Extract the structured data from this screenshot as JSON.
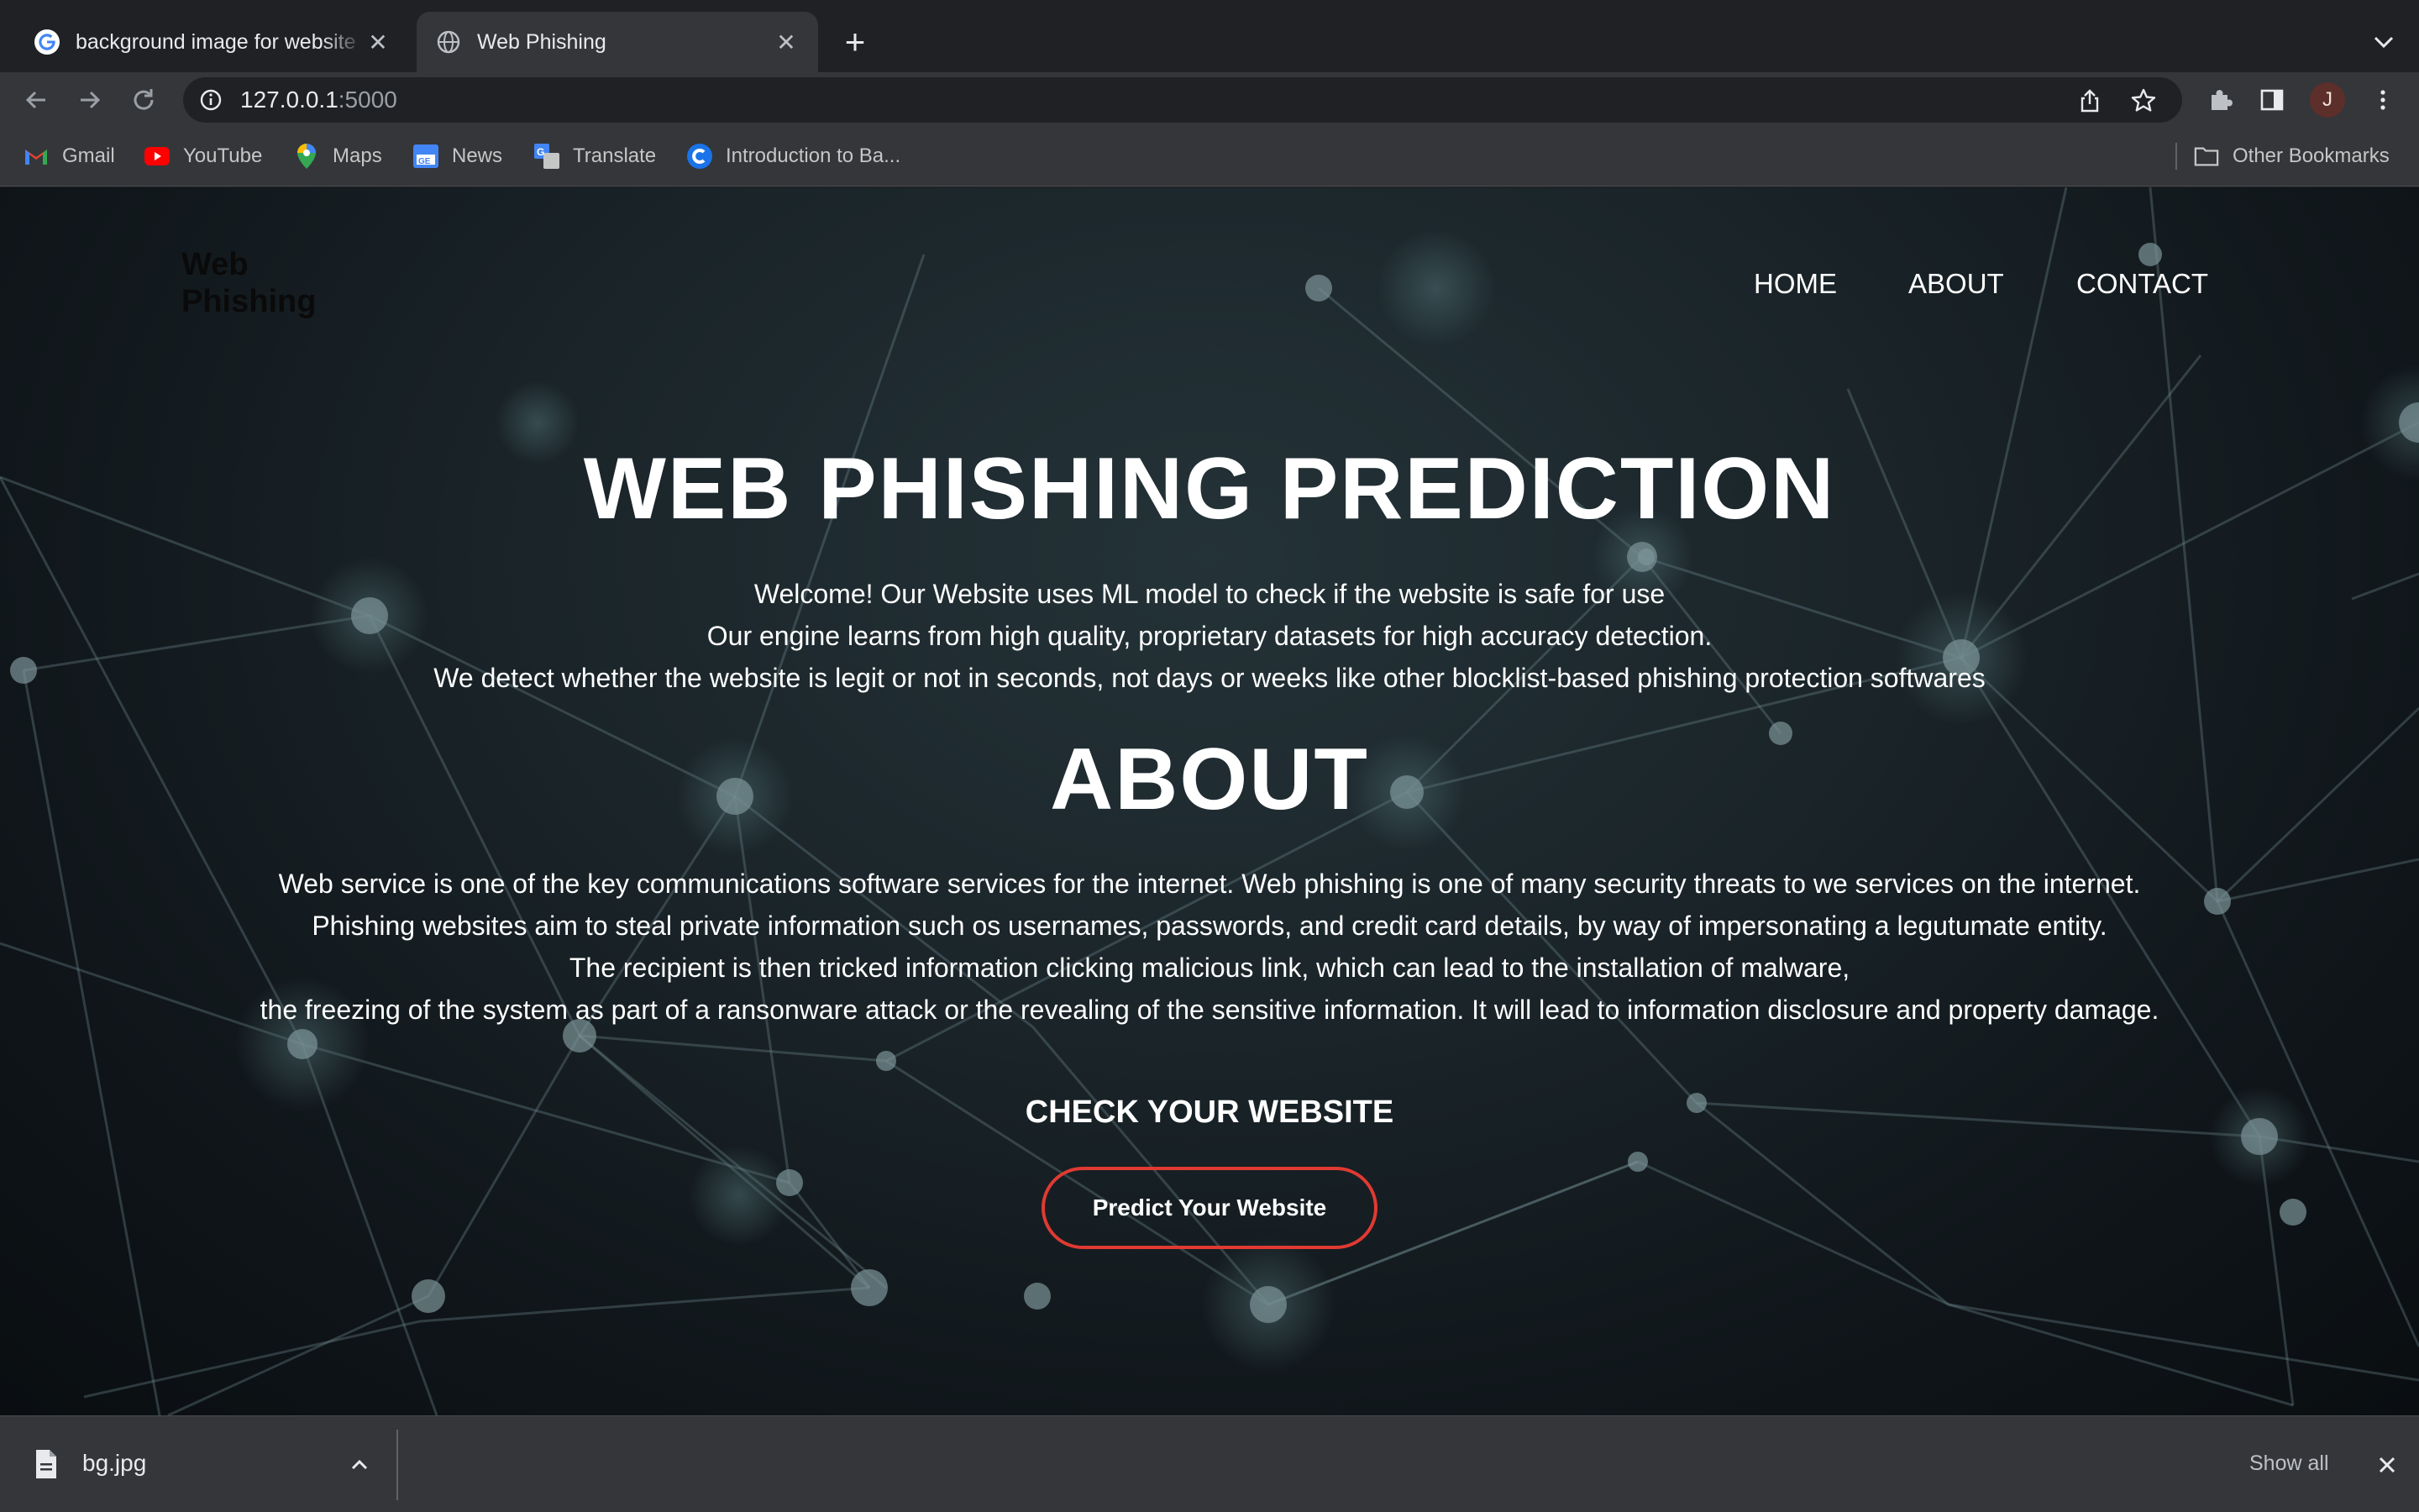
{
  "browser": {
    "tabs": [
      {
        "title": "background image for website",
        "active": false,
        "favicon": "google-g-icon"
      },
      {
        "title": "Web Phishing",
        "active": true,
        "favicon": "globe-icon"
      }
    ],
    "address": {
      "host": "127.0.0.1",
      "port": ":5000"
    },
    "bookmarks": [
      {
        "label": "Gmail",
        "icon": "gmail-icon"
      },
      {
        "label": "YouTube",
        "icon": "youtube-icon"
      },
      {
        "label": "Maps",
        "icon": "maps-icon"
      },
      {
        "label": "News",
        "icon": "news-icon"
      },
      {
        "label": "Translate",
        "icon": "translate-icon"
      },
      {
        "label": "Introduction to Ba...",
        "icon": "c-icon"
      }
    ],
    "other_bookmarks": "Other Bookmarks",
    "profile_initial": "J"
  },
  "site": {
    "brand": "Web Phishing",
    "nav": [
      "HOME",
      "ABOUT",
      "CONTACT"
    ],
    "hero_title": "WEB PHISHING PREDICTION",
    "intro_lines": [
      "Welcome! Our Website uses ML model to check if the website is safe for use",
      "Our engine learns from high quality, proprietary datasets for high accuracy detection.",
      "We detect whether the website is legit or not in seconds, not days or weeks like other blocklist-based phishing protection softwares"
    ],
    "about_title": "ABOUT",
    "about_lines": [
      "Web service is one of the key communications software services for the internet. Web phishing is one of many security threats to we services on the internet.",
      "Phishing websites aim to steal private information such os usernames, passwords, and credit card details, by way of impersonating a legutumate entity.",
      "The recipient is then tricked information clicking malicious link, which can lead to the installation of malware,",
      "the freezing of the system as part of a ransonware attack or the revealing of the sensitive information. It will lead to information disclosure and property damage."
    ],
    "check_heading": "CHECK YOUR WEBSITE",
    "predict_button": "Predict Your Website"
  },
  "downloads": {
    "file_name": "bg.jpg",
    "show_all": "Show all"
  },
  "colors": {
    "chrome_dark": "#202124",
    "chrome_toolbar": "#35363a",
    "button_border": "#e03a32"
  }
}
